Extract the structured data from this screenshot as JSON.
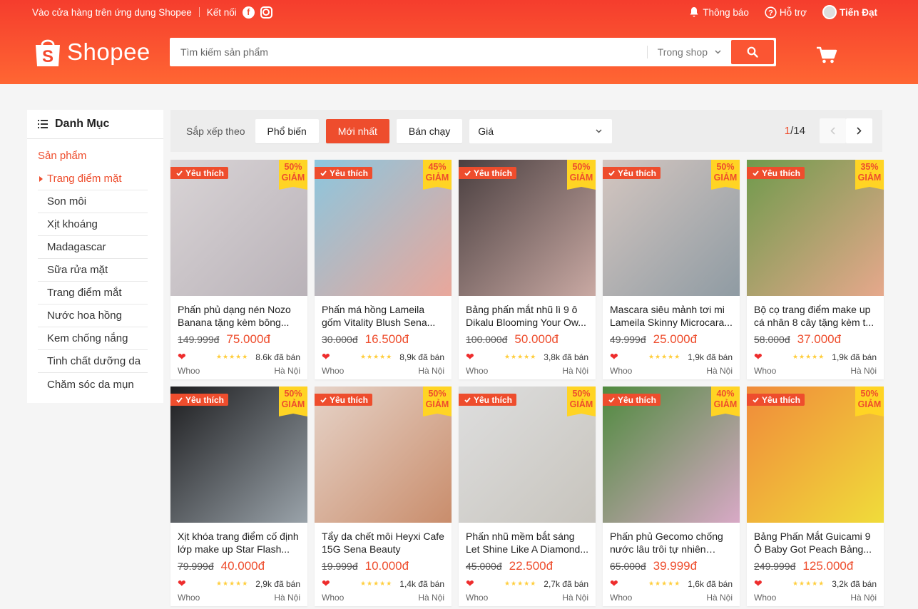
{
  "topbar": {
    "store_text": "Vào cửa hàng trên ứng dụng Shopee",
    "connect_text": "Kết nối",
    "notifications": "Thông báo",
    "help": "Hỗ trợ",
    "user": "Tiến Đạt"
  },
  "header": {
    "logo_text": "Shopee",
    "search_placeholder": "Tìm kiếm sản phẩm",
    "search_scope": "Trong shop"
  },
  "sidebar": {
    "heading": "Danh Mục",
    "section": "Sản phẩm",
    "items": [
      "Trang điểm mặt",
      "Son môi",
      "Xịt khoáng",
      "Madagascar",
      "Sữa rửa mặt",
      "Trang điểm mắt",
      "Nước hoa hồng",
      "Kem chống nắng",
      "Tinh chất dưỡng da",
      "Chăm sóc da mụn"
    ]
  },
  "sortbar": {
    "label": "Sắp xếp theo",
    "options": [
      "Phổ biến",
      "Mới nhất",
      "Bán chạy"
    ],
    "price": "Giá",
    "page_current": "1",
    "page_total": "/14"
  },
  "badges": {
    "favorite": "Yêu thích",
    "discount_word": "GIẢM"
  },
  "products": [
    {
      "name": "Phấn phủ dạng nén Nozo Banana tặng kèm bông...",
      "old": "149.999đ",
      "new": "75.000đ",
      "sold": "8.6k đã bán",
      "brand": "Whoo",
      "loc": "Hà Nội",
      "discount": "50%",
      "img": [
        "#d9d4d6",
        "#b9b2b8"
      ]
    },
    {
      "name": "Phấn má hồng Lameila gốm Vitality Blush Sena...",
      "old": "30.000đ",
      "new": "16.500đ",
      "sold": "8,9k đã bán",
      "brand": "Whoo",
      "loc": "Hà Nội",
      "discount": "45%",
      "img": [
        "#8cc6de",
        "#e9a79b"
      ]
    },
    {
      "name": "Bảng phấn mắt nhũ lì 9 ô Dikalu Blooming Your Ow...",
      "old": "100.000đ",
      "new": "50.000đ",
      "sold": "3,8k đã bán",
      "brand": "Whoo",
      "loc": "Hà Nội",
      "discount": "50%",
      "img": [
        "#4a3f40",
        "#c9a9a3"
      ]
    },
    {
      "name": "Mascara siêu mảnh tơi mi Lameila Skinny Microcara...",
      "old": "49.999đ",
      "new": "25.000đ",
      "sold": "1,9k đã bán",
      "brand": "Whoo",
      "loc": "Hà Nội",
      "discount": "50%",
      "img": [
        "#d4c6c0",
        "#8f9ba3"
      ]
    },
    {
      "name": "Bộ cọ trang điểm make up cá nhân 8 cây tặng kèm t...",
      "old": "58.000đ",
      "new": "37.000đ",
      "sold": "1,9k đã bán",
      "brand": "Whoo",
      "loc": "Hà Nội",
      "discount": "35%",
      "img": [
        "#6f9a4c",
        "#e6a88c"
      ]
    },
    {
      "name": "Xịt khóa trang điểm cố định lớp make up Star Flash...",
      "old": "79.999đ",
      "new": "40.000đ",
      "sold": "2,9k đã bán",
      "brand": "Whoo",
      "loc": "Hà Nội",
      "discount": "50%",
      "img": [
        "#1d1d1f",
        "#9aa3aa"
      ]
    },
    {
      "name": "Tẩy da chết môi Heyxi Cafe 15G Sena Beauty",
      "old": "19.999đ",
      "new": "10.000đ",
      "sold": "1,4k đã bán",
      "brand": "Whoo",
      "loc": "Hà Nội",
      "discount": "50%",
      "img": [
        "#e6d3c8",
        "#c98d6c"
      ]
    },
    {
      "name": "Phấn nhũ mềm bắt sáng Let Shine Like A Diamond...",
      "old": "45.000đ",
      "new": "22.500đ",
      "sold": "2,7k đã bán",
      "brand": "Whoo",
      "loc": "Hà Nội",
      "discount": "50%",
      "img": [
        "#dedede",
        "#c7c4bd"
      ]
    },
    {
      "name": "Phấn phủ Gecomo chống nước lâu trôi tự nhiên chấ...",
      "old": "65.000đ",
      "new": "39.999đ",
      "sold": "1,6k đã bán",
      "brand": "Whoo",
      "loc": "Hà Nội",
      "discount": "40%",
      "img": [
        "#4f8a3e",
        "#d8a9c6"
      ]
    },
    {
      "name": "Bảng Phấn Mắt Guicami 9 Ô Baby Got Peach Bảng...",
      "old": "249.999đ",
      "new": "125.000đ",
      "sold": "3,2k đã bán",
      "brand": "Whoo",
      "loc": "Hà Nội",
      "discount": "50%",
      "img": [
        "#f08a3a",
        "#f0dc3a"
      ]
    }
  ],
  "colors": {
    "brand": "#ee4d2d",
    "badge": "#ffd424"
  }
}
